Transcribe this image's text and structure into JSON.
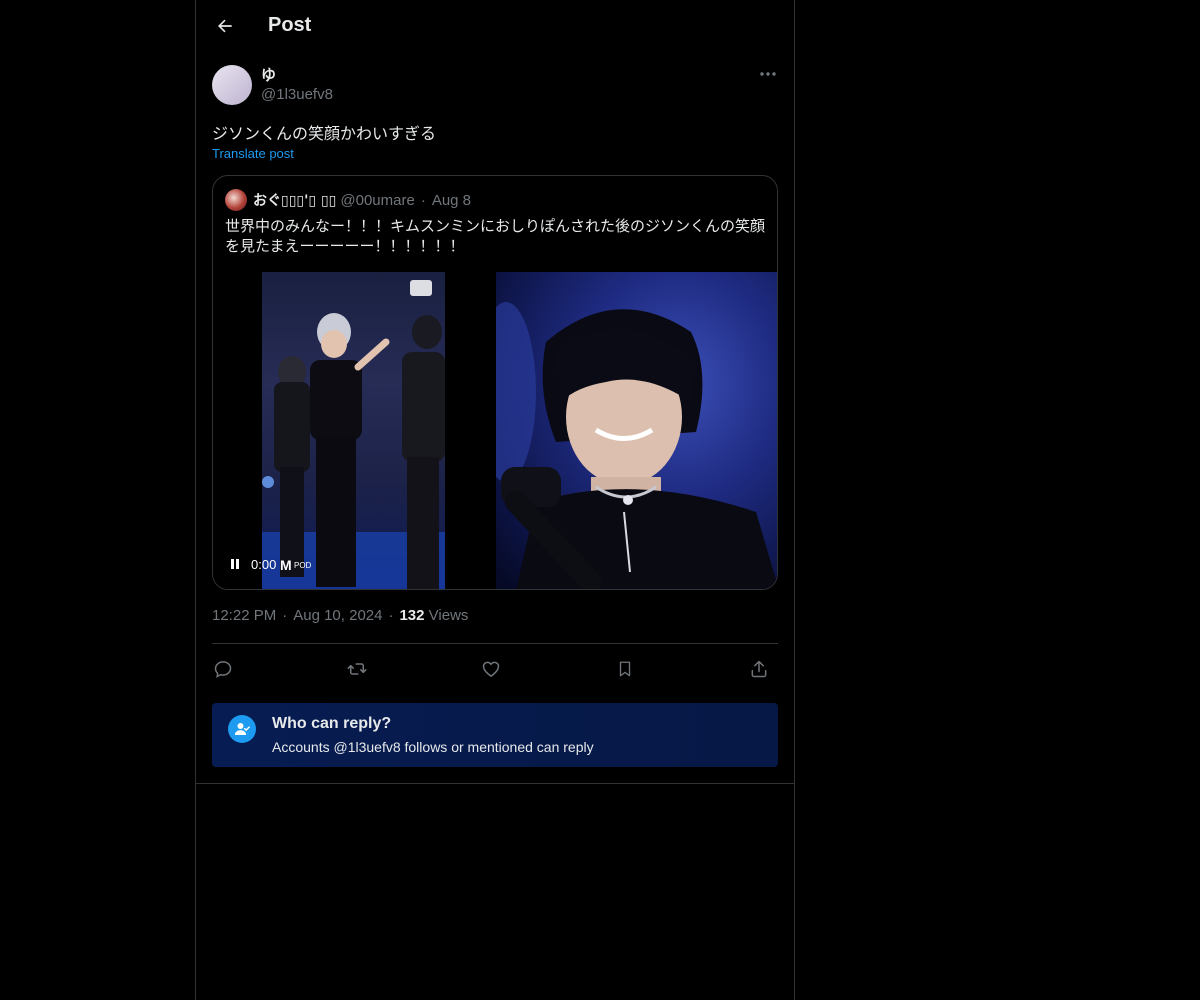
{
  "header": {
    "title": "Post"
  },
  "author": {
    "name": "ゆ",
    "handle": "@1l3uefv8"
  },
  "post": {
    "text": "ジソンくんの笑顔かわいすぎる",
    "translate_label": "Translate post"
  },
  "quote": {
    "name": "おぐ▯▯▯'▯ ▯▯",
    "handle": "@00umare",
    "date": "Aug 8",
    "text": "世界中のみんなー！！！キムスンミンにおしりぽんされた後のジソンくんの笑顔を見たまえーーーーー！！！！！！",
    "video": {
      "time": "0:00"
    }
  },
  "meta": {
    "time": "12:22 PM",
    "date": "Aug 10, 2024",
    "views_count": "132",
    "views_label": "Views"
  },
  "reply_restriction": {
    "title": "Who can reply?",
    "subtitle": "Accounts @1l3uefv8 follows or mentioned can reply"
  },
  "colors": {
    "background": "#000000",
    "accent": "#1d9bf0",
    "text": "#e7e9ea",
    "muted": "#71767b",
    "border": "#2f3336"
  }
}
